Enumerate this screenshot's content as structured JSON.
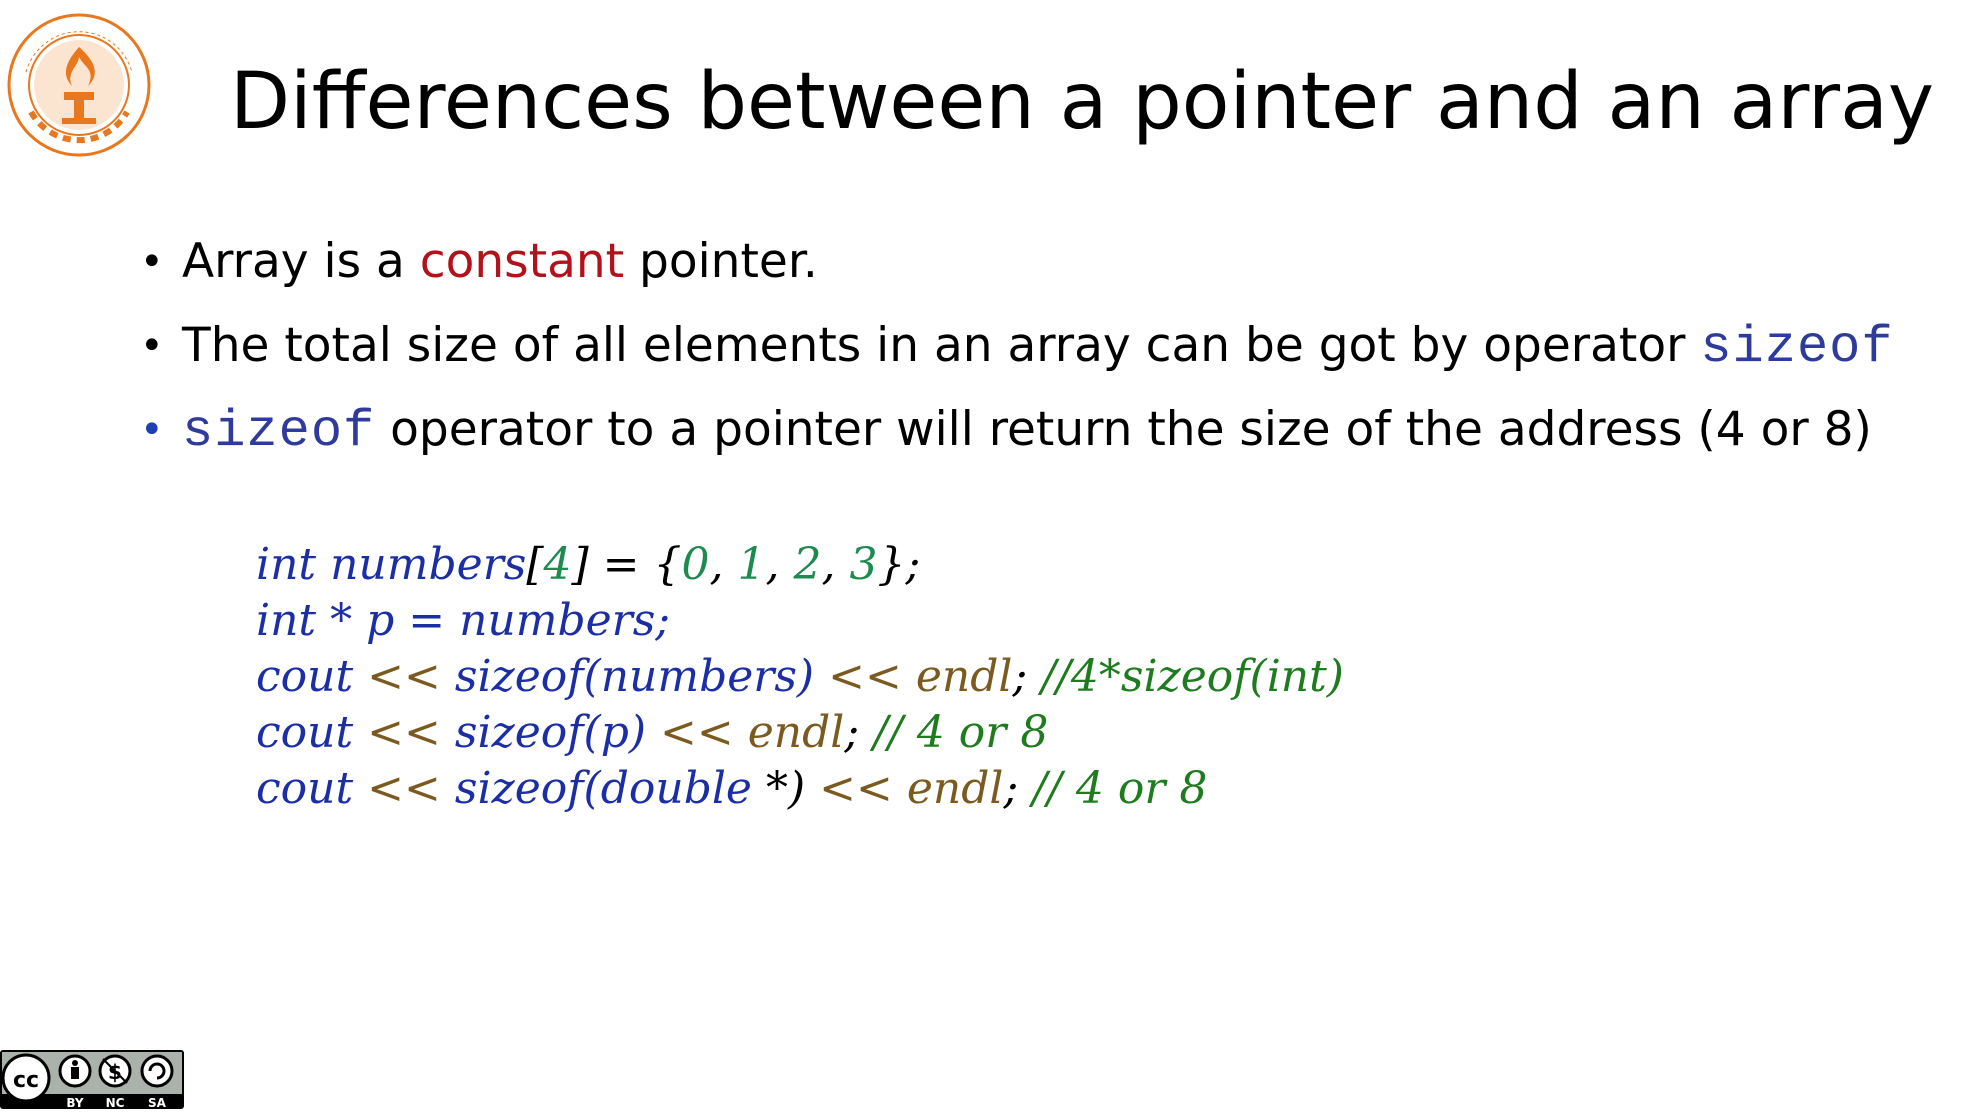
{
  "logo": {
    "name": "university-seal"
  },
  "title": "Differences between a pointer and an array",
  "bullets": [
    {
      "pre": "Array is a ",
      "highlight": "constant",
      "post": " pointer."
    },
    {
      "text": "The total size of all elements in an array can be got by operator ",
      "code": "sizeof"
    },
    {
      "code": "sizeof",
      "text": " operator to a pointer will return the size of the address (4 or 8)"
    }
  ],
  "code": {
    "line1": {
      "kw": "int",
      "name": "numbers",
      "lb": "[",
      "size": "4",
      "rb": "]",
      "eq": " = {",
      "v0": "0",
      "c0": ", ",
      "v1": "1",
      "c1": ", ",
      "v2": "2",
      "c2": ", ",
      "v3": "3",
      "end": "};"
    },
    "line2": {
      "kw": "int",
      "rest": " * p = numbers;"
    },
    "line3": {
      "cout": "cout",
      "op1": " << ",
      "fn": "sizeof",
      "arg": "(numbers)",
      "op2": " << ",
      "endl": "endl",
      "semi": "; ",
      "comment": "//4*sizeof(int)"
    },
    "line4": {
      "cout": "cout",
      "op1": " << ",
      "fn": "sizeof",
      "arg": "(p)",
      "op2": " << ",
      "endl": "endl",
      "semi": "; ",
      "comment": "// 4 or 8"
    },
    "line5": {
      "cout": "cout",
      "op1": " << ",
      "fn": "sizeof",
      "lp": "(",
      "type": "double",
      "star": " *)",
      "op2": " << ",
      "endl": "endl",
      "semi": "; ",
      "comment": "// 4 or 8"
    }
  },
  "license": {
    "labels": [
      "BY",
      "NC",
      "SA"
    ],
    "cc": "cc"
  },
  "colors": {
    "highlight": "#b3121b",
    "code_blue": "#1c2ea6",
    "comment_green": "#1e7b1e",
    "logo_orange": "#e8771d"
  }
}
